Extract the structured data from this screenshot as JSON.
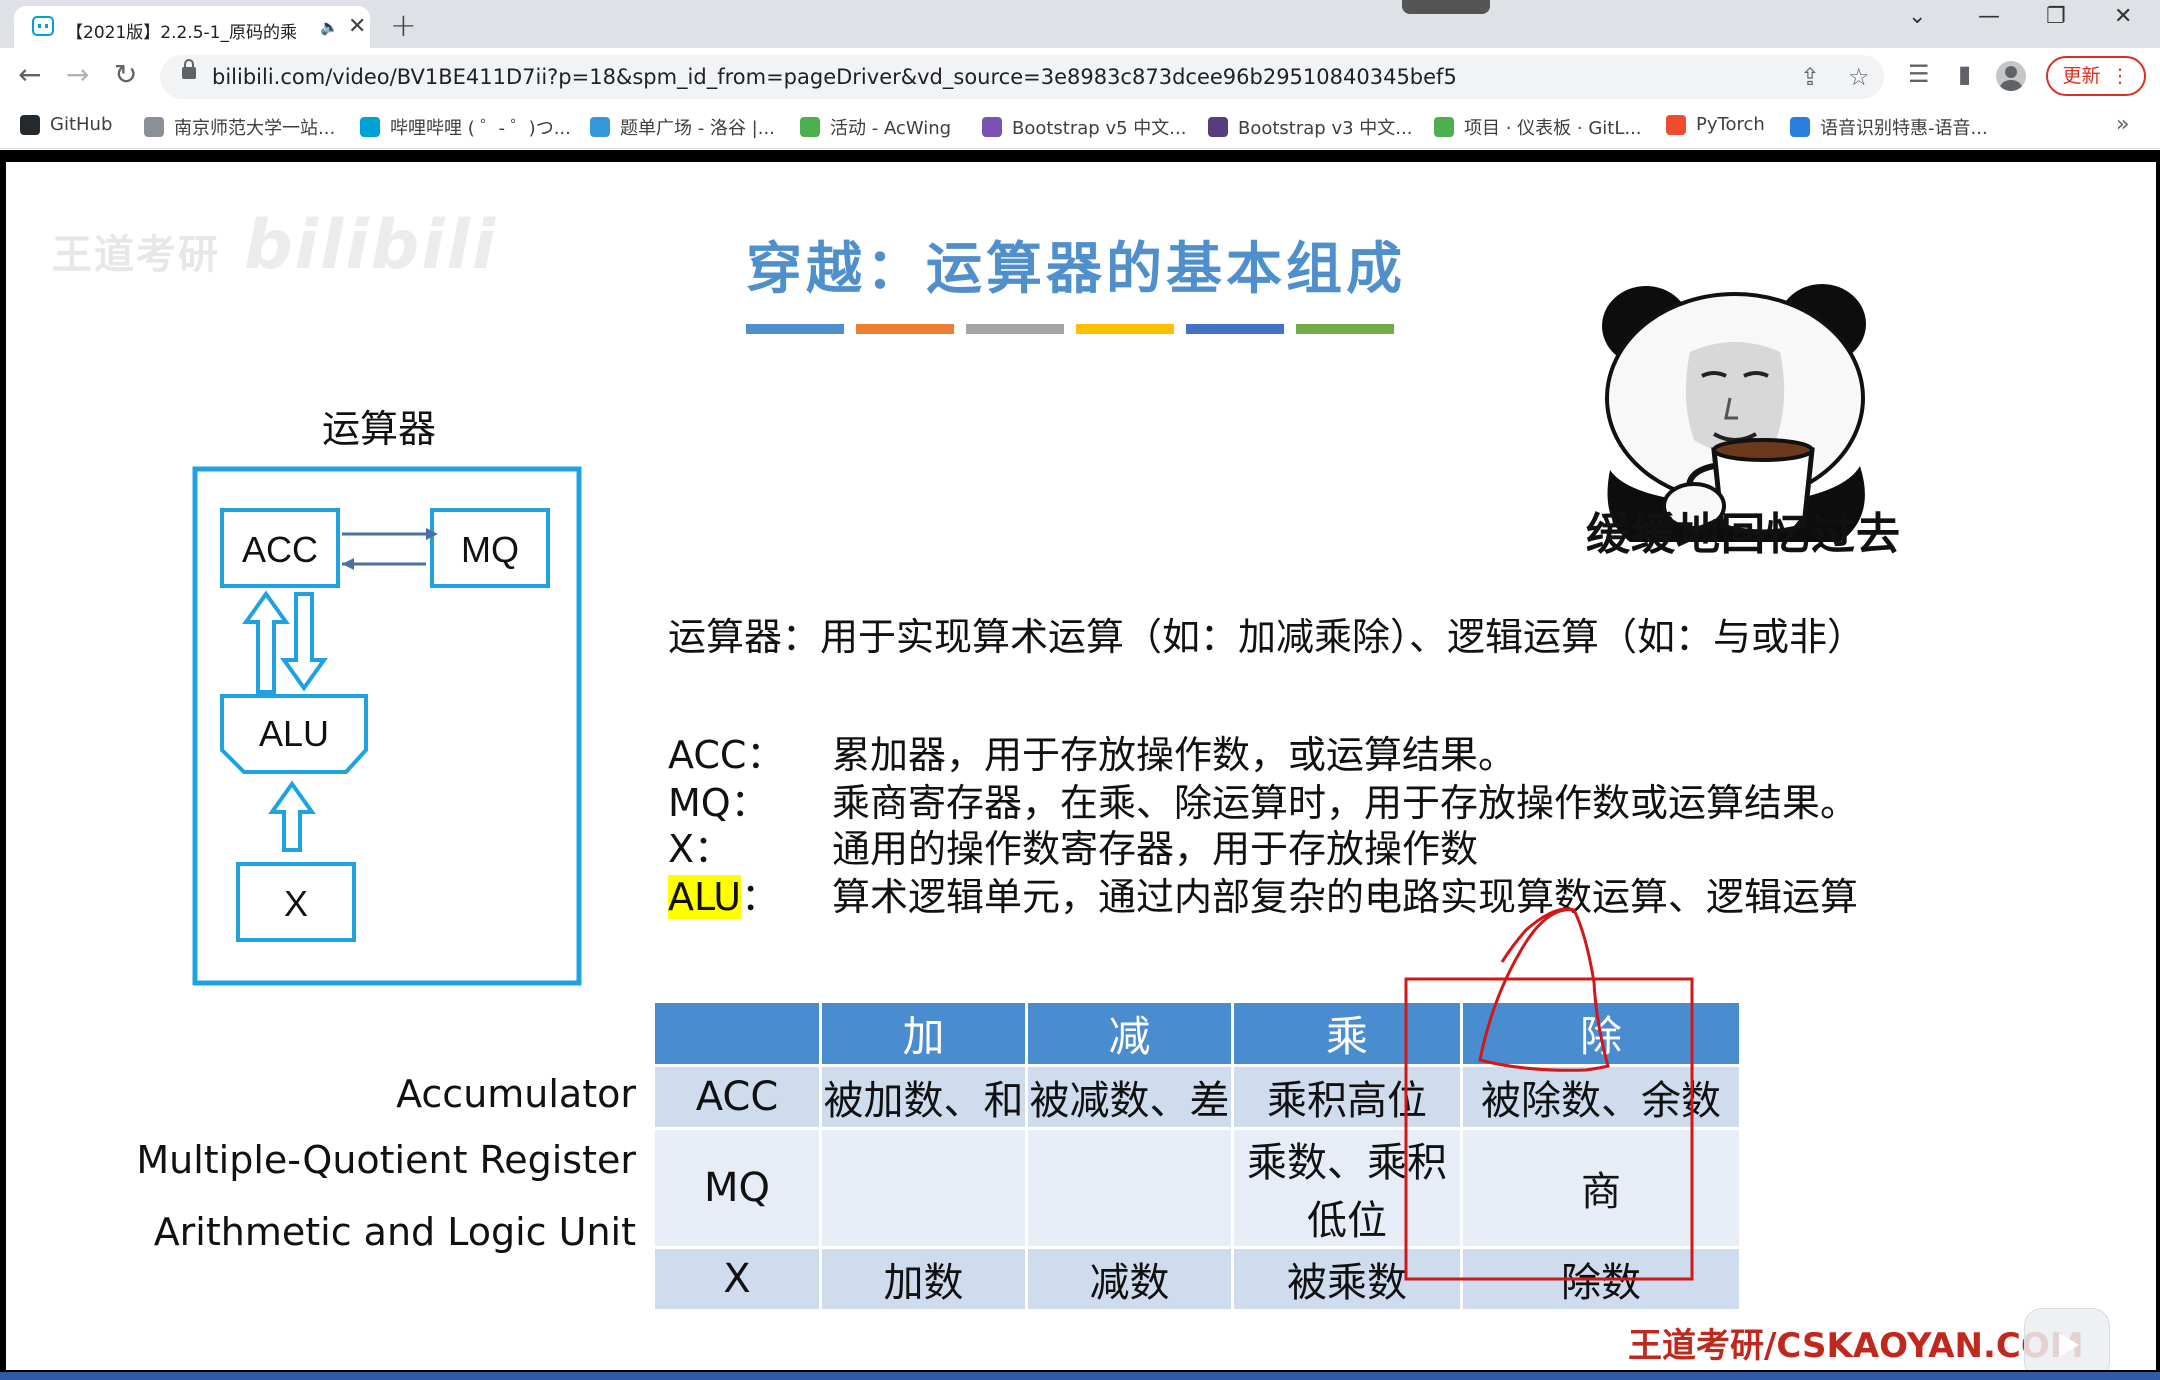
{
  "browser": {
    "tab_title": "【2021版】2.2.5-1_原码的乘",
    "url": "bilibili.com/video/BV1BE411D7ii?p=18&spm_id_from=pageDriver&vd_source=3e8983c873dcee96b29510840345bef5",
    "update_label": "更新",
    "bookmarks": [
      {
        "label": "GitHub",
        "icon": "github-icon",
        "color": "#24292e"
      },
      {
        "label": "南京师范大学一站...",
        "icon": "house-icon",
        "color": "#8a8f98"
      },
      {
        "label": "哔哩哔哩 ( ゜- ゜)つ...",
        "icon": "bilibili-icon",
        "color": "#00a1d6"
      },
      {
        "label": "题单广场 - 洛谷 |...",
        "icon": "luogu-icon",
        "color": "#3498db"
      },
      {
        "label": "活动 - AcWing",
        "icon": "acwing-icon",
        "color": "#4caf50"
      },
      {
        "label": "Bootstrap v5 中文...",
        "icon": "bootstrap-icon",
        "color": "#7952b3"
      },
      {
        "label": "Bootstrap v3 中文...",
        "icon": "bootstrap-icon",
        "color": "#563d7c"
      },
      {
        "label": "项目 · 仪表板 · GitL...",
        "icon": "gitlab-icon",
        "color": "#4caf50"
      },
      {
        "label": "PyTorch",
        "icon": "pytorch-icon",
        "color": "#ee4c2c"
      },
      {
        "label": "语音识别特惠-语音...",
        "icon": "cloud-icon",
        "color": "#2a7de1"
      }
    ]
  },
  "slide": {
    "watermark": "王道考研",
    "watermark_logo": "bilibili",
    "title": "穿越：运算器的基本组成",
    "stripe_colors": [
      "#4f8fcb",
      "#ed7d31",
      "#a5a5a5",
      "#ffc000",
      "#4472c4",
      "#70ad47"
    ],
    "meme_caption": "缓缓地回忆过去",
    "diagram": {
      "label": "运算器",
      "acc": "ACC",
      "mq": "MQ",
      "alu": "ALU",
      "x": "X",
      "border_color": "#1ea3e0"
    },
    "intro": "运算器：用于实现算术运算（如：加减乘除）、逻辑运算（如：与或非）",
    "definitions": [
      {
        "term": "ACC：",
        "desc": "累加器，用于存放操作数，或运算结果。"
      },
      {
        "term": "MQ：",
        "desc": "乘商寄存器，在乘、除运算时，用于存放操作数或运算结果。"
      },
      {
        "term": "X：",
        "desc": "通用的操作数寄存器，用于存放操作数"
      },
      {
        "term_highlight": "ALU",
        "term_suffix": "：",
        "desc": "算术逻辑单元，通过内部复杂的电路实现算数运算、逻辑运算"
      }
    ],
    "row_labels": [
      "Accumulator",
      "Multiple-Quotient Register",
      "Arithmetic and Logic Unit"
    ],
    "table": {
      "headers": [
        "",
        "加",
        "减",
        "乘",
        "除"
      ],
      "rows": [
        [
          "ACC",
          "被加数、和",
          "被减数、差",
          "乘积高位",
          "被除数、余数"
        ],
        [
          "MQ",
          "",
          "",
          "乘数、乘积低位",
          "商"
        ],
        [
          "X",
          "加数",
          "减数",
          "被乘数",
          "除数"
        ]
      ]
    },
    "brand": "王道考研/CSKAOYAN.COM",
    "annotation_color": "#d01818"
  }
}
